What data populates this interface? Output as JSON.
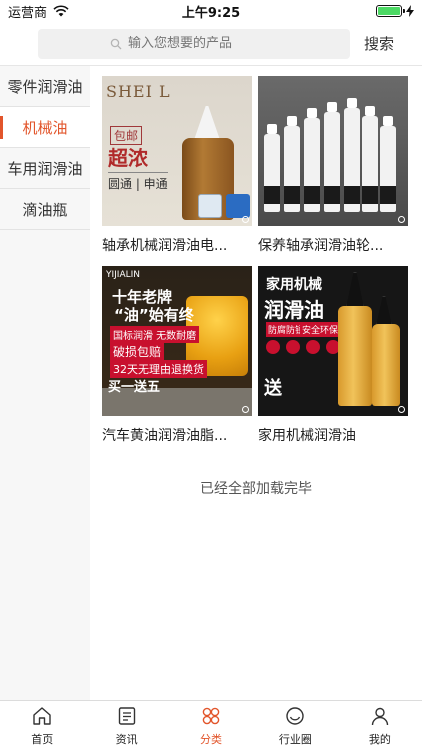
{
  "status_bar": {
    "carrier": "运营商",
    "time": "上午9:25"
  },
  "header": {
    "search_placeholder": "输入您想要的产品",
    "search_button": "搜索"
  },
  "sidebar": {
    "items": [
      {
        "label": "零件润滑油",
        "active": false
      },
      {
        "label": "机械油",
        "active": true
      },
      {
        "label": "车用润滑油",
        "active": false
      },
      {
        "label": "滴油瓶",
        "active": false
      }
    ]
  },
  "products": [
    {
      "title": "轴承机械润滑油电...",
      "image_text": {
        "brand": "SHEI L",
        "tag": "包邮",
        "big": "超浓",
        "small": "圆通 | 申通"
      }
    },
    {
      "title": "保养轴承润滑油轮..."
    },
    {
      "title": "汽车黄油润滑油脂...",
      "image_text": {
        "brand": "YIJIALIN",
        "line1": "十年老牌",
        "line2": "“油”始有终",
        "line3": "国标润滑 无数耐磨",
        "line4": "破损包赔",
        "line5": "32天无理由退换货",
        "line6": "买一送五"
      }
    },
    {
      "title": "家用机械润滑油",
      "image_text": {
        "line1": "家用机械",
        "line2": "润滑油",
        "tag1": "防腐防锈",
        "tag2": "安全环保",
        "line3": "送"
      }
    }
  ],
  "end_text": "已经全部加载完毕",
  "tabbar": {
    "items": [
      {
        "label": "首页",
        "icon": "home-icon",
        "active": false
      },
      {
        "label": "资讯",
        "icon": "news-icon",
        "active": false
      },
      {
        "label": "分类",
        "icon": "category-icon",
        "active": true
      },
      {
        "label": "行业圈",
        "icon": "circle-icon",
        "active": false
      },
      {
        "label": "我的",
        "icon": "user-icon",
        "active": false
      }
    ]
  },
  "colors": {
    "accent": "#e2552b",
    "battery": "#4cd964",
    "sidebar_bg": "#f7f7f7"
  }
}
